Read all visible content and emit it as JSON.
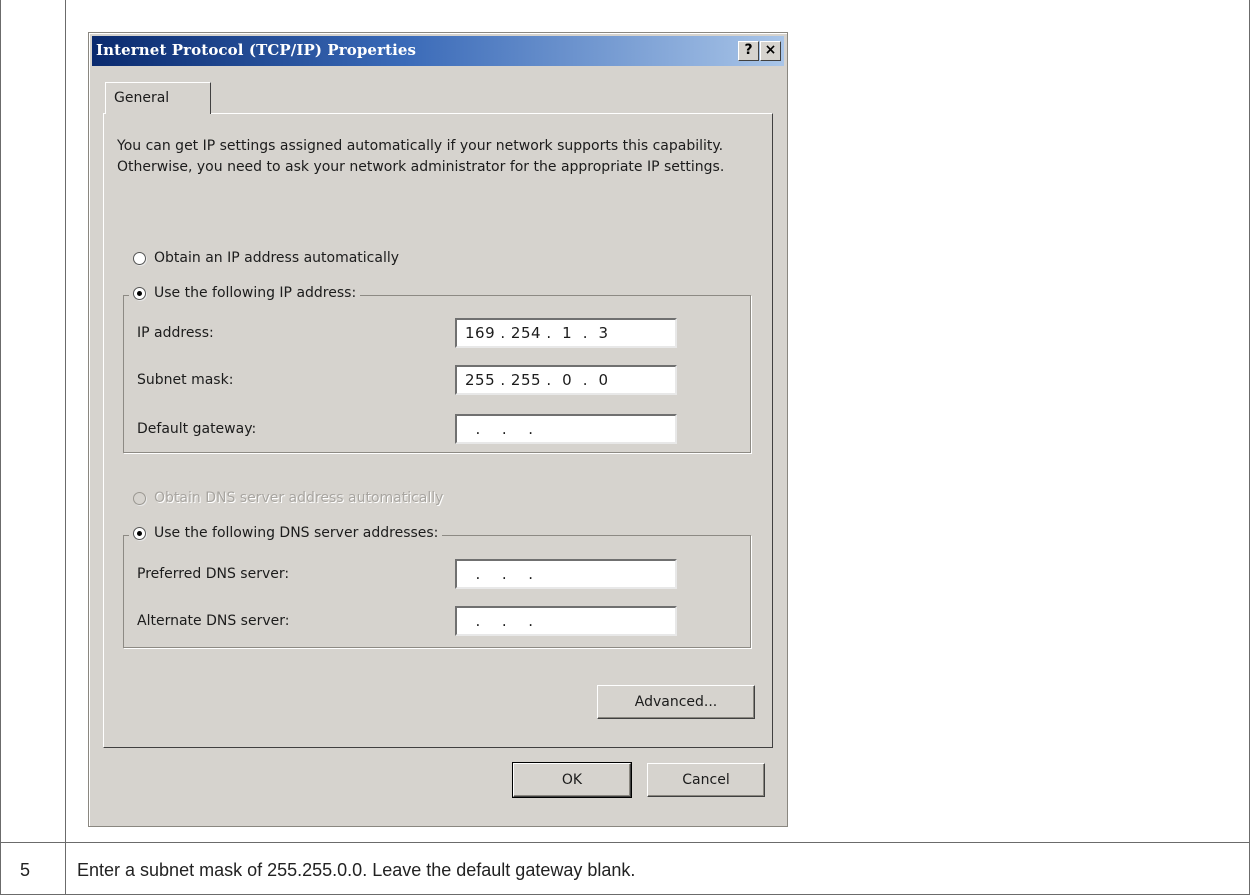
{
  "dialog": {
    "title": "Internet Protocol (TCP/IP) Properties",
    "help_button": "?",
    "close_button": "×",
    "tab_general": "General",
    "intro": "You can get IP settings assigned automatically if your network supports this capability. Otherwise, you need to ask your network administrator for the appropriate IP settings.",
    "radio_auto_ip": {
      "label": "Obtain an IP address automatically",
      "selected": false
    },
    "radio_static_ip": {
      "label": "Use the following IP address:",
      "selected": true
    },
    "ip_address": {
      "label": "IP address:",
      "value": "169 . 254 .  1  .  3"
    },
    "subnet_mask": {
      "label": "Subnet mask:",
      "value": "255 . 255 .  0  .  0"
    },
    "default_gateway": {
      "label": "Default gateway:",
      "value": "  .    .    ."
    },
    "radio_auto_dns": {
      "label": "Obtain DNS server address automatically",
      "selected": false,
      "enabled": false
    },
    "radio_static_dns": {
      "label": "Use the following DNS server addresses:",
      "selected": true
    },
    "preferred_dns": {
      "label": "Preferred DNS server:",
      "value": "  .    .    ."
    },
    "alternate_dns": {
      "label": "Alternate DNS server:",
      "value": "  .    .    ."
    },
    "advanced_button": "Advanced...",
    "ok_button": "OK",
    "cancel_button": "Cancel"
  },
  "step": {
    "number": "5",
    "text": "Enter a subnet mask of 255.255.0.0. Leave the default gateway blank."
  },
  "colors": {
    "dialog_face": "#d6d3ce",
    "titlebar_start": "#0a2a6e",
    "titlebar_end": "#a9c5e8"
  }
}
